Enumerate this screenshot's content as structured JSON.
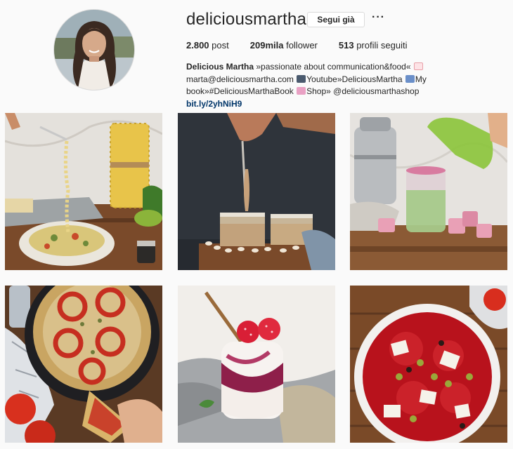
{
  "profile": {
    "username": "deliciousmartha",
    "follow_label": "Segui già",
    "more_label": "···",
    "stats": [
      {
        "value": "2.800",
        "label": "post"
      },
      {
        "value": "209mila",
        "label": "follower"
      },
      {
        "value": "513",
        "label": "profili seguiti"
      }
    ],
    "bio": {
      "name": "Delicious Martha",
      "line1": "»passionate about communication&food«",
      "line2a": "marta@deliciousmartha.com",
      "line2b": "Youtube»DeliciousMartha",
      "line2c": "My",
      "line3a": "book»#DeliciousMarthaBook",
      "line3b": "Shop» @deliciousmarthashop",
      "link": "bit.ly/2yhNiH9"
    }
  },
  "posts": [
    {
      "id": "post-pasta-fork",
      "icon": "pasta-photo"
    },
    {
      "id": "post-tahini-jars",
      "icon": "jars-photo"
    },
    {
      "id": "post-green-smoothie",
      "icon": "smoothie-photo"
    },
    {
      "id": "post-tomato-pie",
      "icon": "pie-photo"
    },
    {
      "id": "post-berry-parfait",
      "icon": "parfait-photo"
    },
    {
      "id": "post-carpaccio",
      "icon": "carpaccio-photo"
    }
  ],
  "colors": {
    "link": "#003569",
    "text": "#262626",
    "border": "#dbdbdb",
    "background": "#fafafa"
  }
}
